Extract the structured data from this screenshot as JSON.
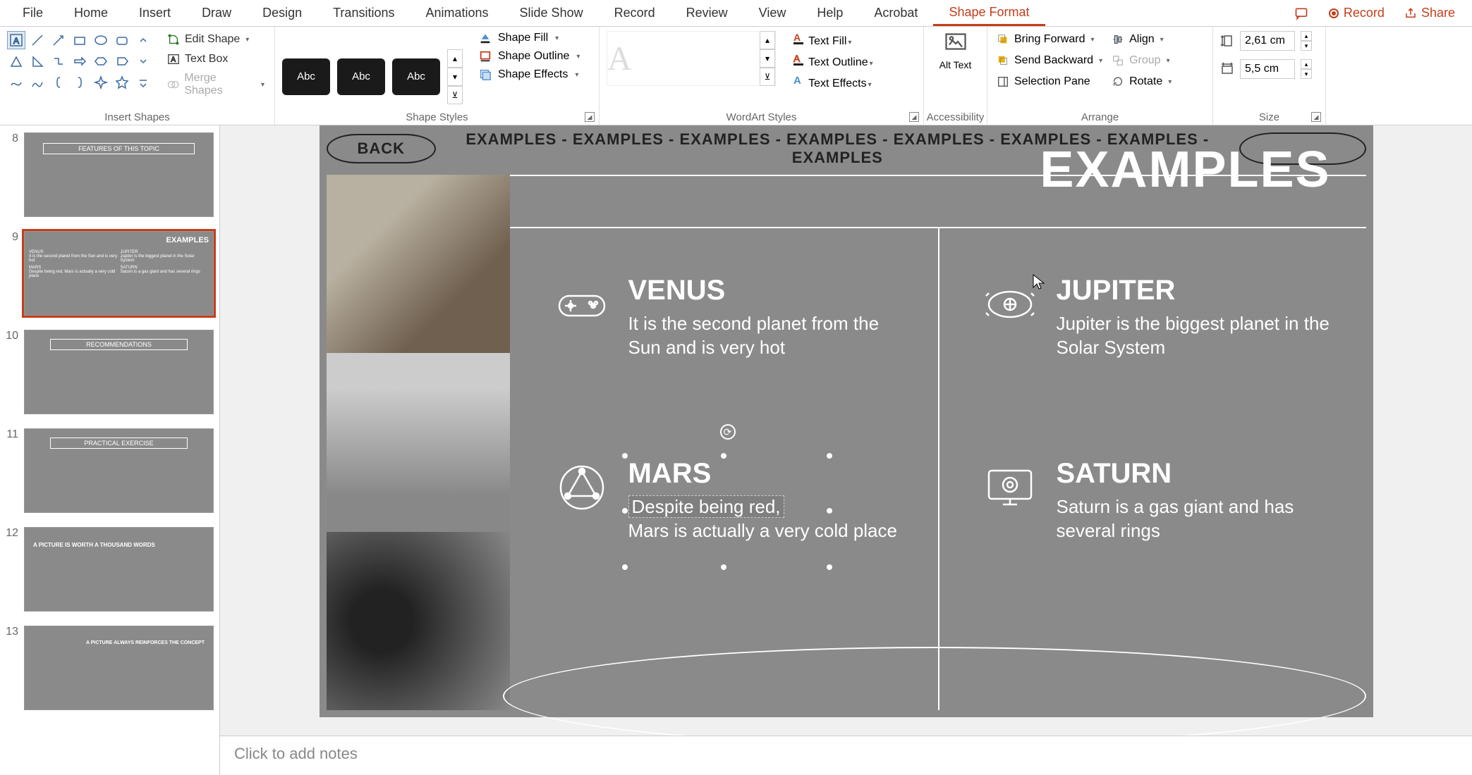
{
  "menubar": {
    "tabs": [
      "File",
      "Home",
      "Insert",
      "Draw",
      "Design",
      "Transitions",
      "Animations",
      "Slide Show",
      "Record",
      "Review",
      "View",
      "Help",
      "Acrobat",
      "Shape Format"
    ],
    "active_tab": "Shape Format",
    "record_btn": "Record",
    "share_btn": "Share"
  },
  "ribbon": {
    "insert_shapes": {
      "label": "Insert Shapes",
      "edit_shape": "Edit Shape",
      "text_box": "Text Box",
      "merge_shapes": "Merge Shapes"
    },
    "shape_styles": {
      "label": "Shape Styles",
      "swatch_text": "Abc",
      "shape_fill": "Shape Fill",
      "shape_outline": "Shape Outline",
      "shape_effects": "Shape Effects"
    },
    "wordart": {
      "label": "WordArt Styles",
      "text_fill": "Text Fill",
      "text_outline": "Text Outline",
      "text_effects": "Text Effects"
    },
    "accessibility": {
      "label": "Accessibility",
      "alt_text": "Alt Text"
    },
    "arrange": {
      "label": "Arrange",
      "bring_forward": "Bring Forward",
      "send_backward": "Send Backward",
      "selection_pane": "Selection Pane",
      "align": "Align",
      "group": "Group",
      "rotate": "Rotate"
    },
    "size": {
      "label": "Size",
      "height": "2,61 cm",
      "width": "5,5 cm"
    }
  },
  "thumbnails": [
    {
      "num": "8",
      "title": "FEATURES OF THIS TOPIC"
    },
    {
      "num": "9",
      "title": "EXAMPLES",
      "selected": true
    },
    {
      "num": "10",
      "title": "RECOMMENDATIONS"
    },
    {
      "num": "11",
      "title": "PRACTICAL EXERCISE"
    },
    {
      "num": "12",
      "title": "A PICTURE IS WORTH A THOUSAND WORDS"
    },
    {
      "num": "13",
      "title": "A PICTURE ALWAYS REINFORCES THE CONCEPT"
    }
  ],
  "slide": {
    "back": "BACK",
    "header_strip": "EXAMPLES - EXAMPLES - EXAMPLES - EXAMPLES - EXAMPLES - EXAMPLES - EXAMPLES - EXAMPLES",
    "title": "EXAMPLES",
    "planets": {
      "venus": {
        "name": "VENUS",
        "desc": "It is the second planet from the Sun and is very hot"
      },
      "jupiter": {
        "name": "JUPITER",
        "desc": "Jupiter is the biggest planet in the Solar System"
      },
      "mars": {
        "name": "MARS",
        "desc_line1": "Despite being red,",
        "desc_rest": "Mars is actually a very cold place"
      },
      "saturn": {
        "name": "SATURN",
        "desc": "Saturn is a gas giant and has several rings"
      }
    }
  },
  "notes": {
    "placeholder": "Click to add notes"
  }
}
